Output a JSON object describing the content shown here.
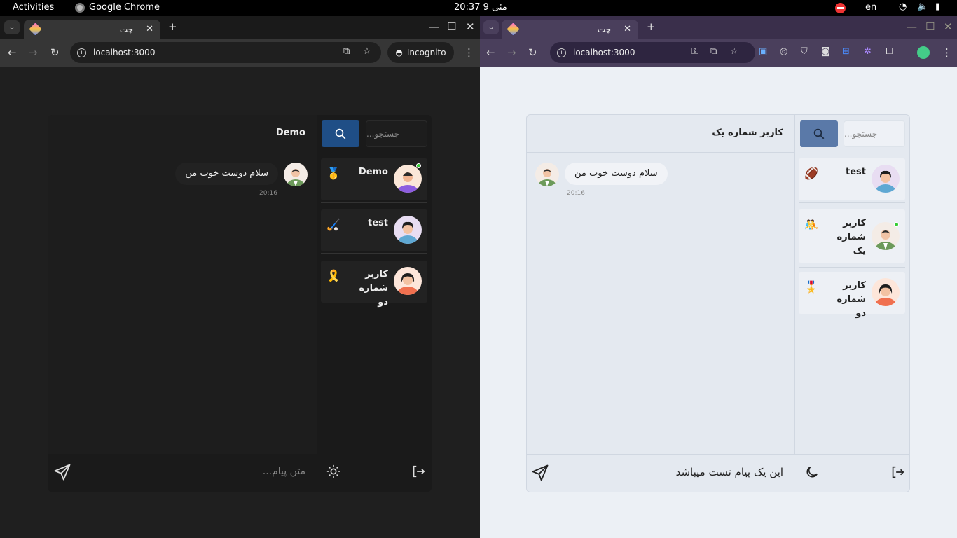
{
  "system": {
    "activities": "Activities",
    "app": "Google Chrome",
    "clock": "20:37  مئی 9",
    "lang": "en"
  },
  "left": {
    "tab_title": "چت",
    "url": "localhost:3000",
    "incognito": "Incognito",
    "search_placeholder": "جستجو...",
    "chat_name": "Demo",
    "contacts": [
      {
        "name": "Demo",
        "emoji": "🥇"
      },
      {
        "name": "test",
        "emoji": "🏑"
      },
      {
        "name": "کاربر شماره دو",
        "emoji": "🎗️"
      }
    ],
    "message": "سلام دوست خوب من",
    "time": "20:16",
    "input_placeholder": "متن پیام..."
  },
  "right": {
    "tab_title": "چت",
    "url": "localhost:3000",
    "search_placeholder": "جستجو...",
    "chat_name": "کاربر شماره یک",
    "contacts": [
      {
        "name": "test",
        "emoji": "🏈"
      },
      {
        "name": "کاربر شماره یک",
        "emoji": "🤼"
      },
      {
        "name": "کاربر شماره دو",
        "emoji": "🎖️"
      }
    ],
    "message": "سلام دوست خوب من",
    "time": "20:16",
    "input_value": "این یک پیام تست میباشد"
  },
  "colors": {
    "accent_dark": "#1f4e86",
    "accent_light": "#5a79a8"
  }
}
